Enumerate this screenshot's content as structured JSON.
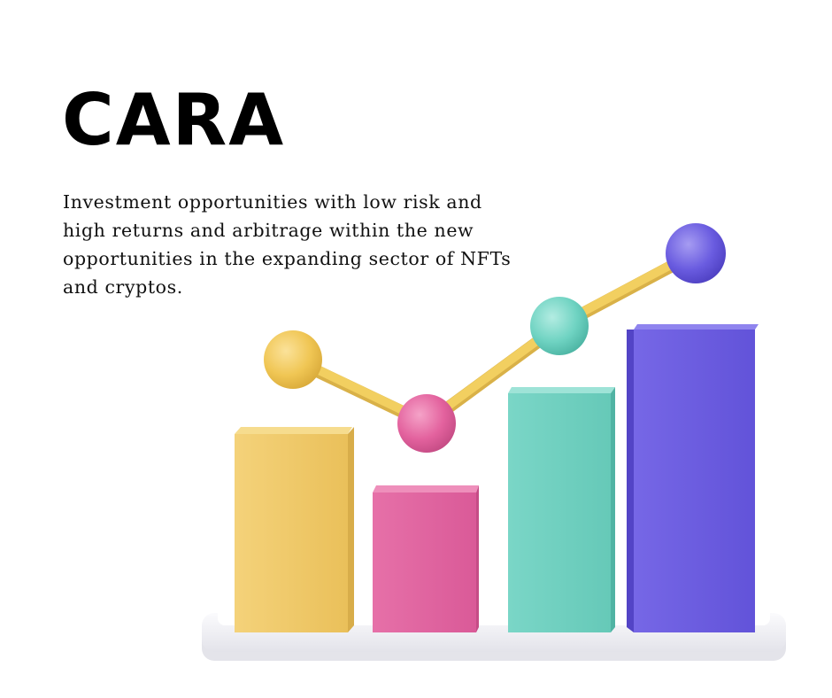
{
  "brand": {
    "title": "CARA"
  },
  "tagline": {
    "text": "Investment opportunities with low risk and high returns and arbitrage within the new opportunities in the expanding sector of NFTs and cryptos."
  },
  "illustration": {
    "icon": "3d-growth-bar-chart-icon",
    "colors": {
      "yellow": "#efc860",
      "pink": "#e0629e",
      "teal": "#6fd0c0",
      "purple": "#6a5ce0",
      "line": "#f2cf60",
      "base": "#f2f2f6"
    }
  }
}
